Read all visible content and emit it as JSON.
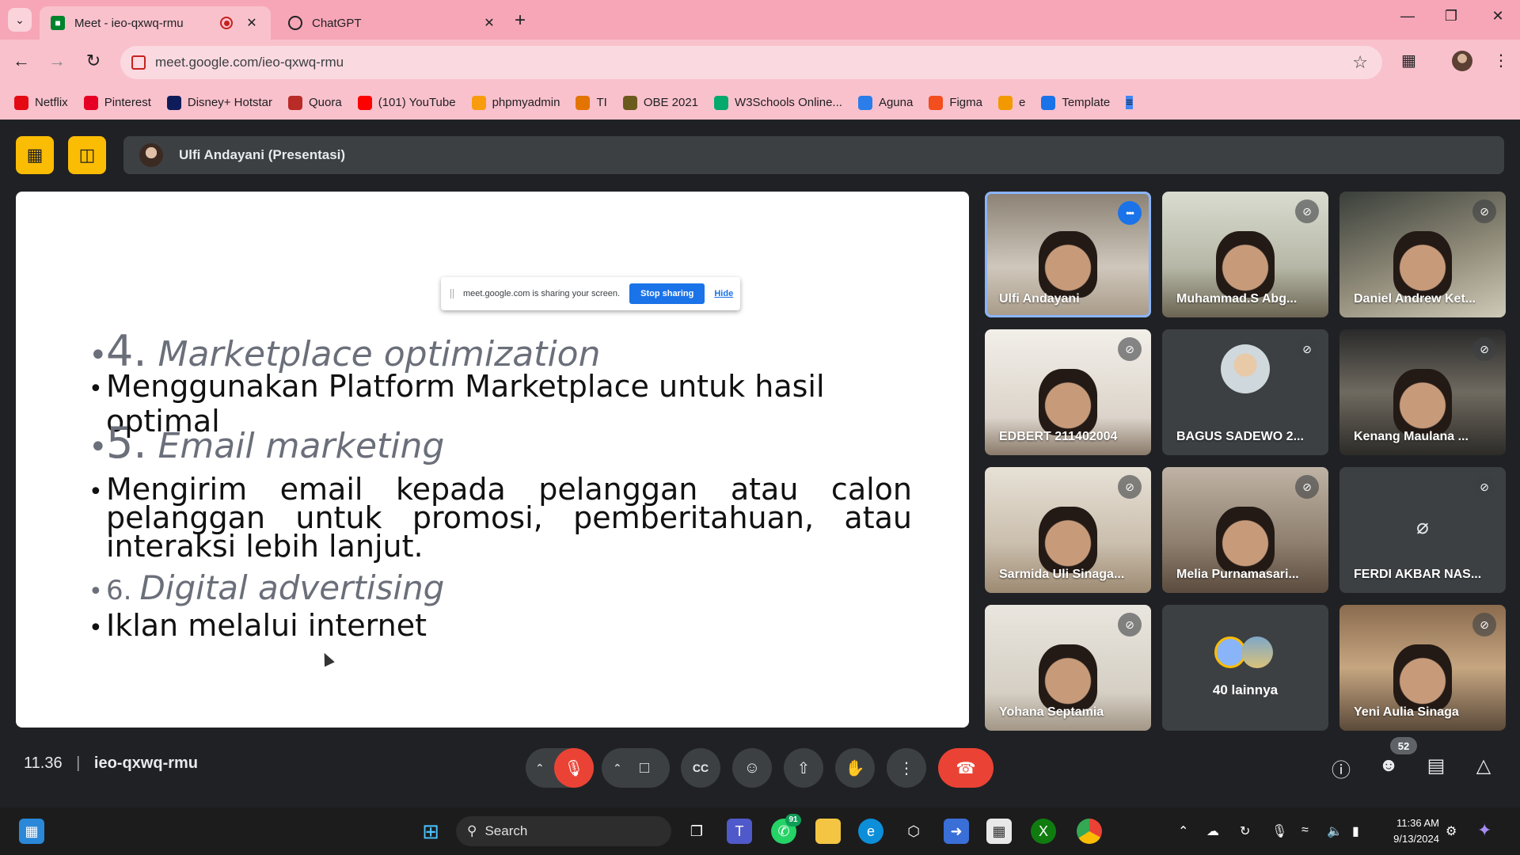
{
  "browser": {
    "tabs": [
      {
        "title": "Meet - ieo-qxwq-rmu",
        "active": true
      },
      {
        "title": "ChatGPT",
        "active": false
      }
    ],
    "url": "meet.google.com/ieo-qxwq-rmu",
    "bookmarks": [
      {
        "label": "Netflix",
        "icon": "netflix-icon",
        "color": "#e50914"
      },
      {
        "label": "Pinterest",
        "icon": "pinterest-icon",
        "color": "#e60023"
      },
      {
        "label": "Disney+ Hotstar",
        "icon": "hotstar-icon",
        "color": "#0f1c5a"
      },
      {
        "label": "Quora",
        "icon": "quora-icon",
        "color": "#b92b27"
      },
      {
        "label": "(101) YouTube",
        "icon": "youtube-icon",
        "color": "#ff0000"
      },
      {
        "label": "phpmyadmin",
        "icon": "phpmyadmin-icon",
        "color": "#f89c0e"
      },
      {
        "label": "TI",
        "icon": "ti-icon",
        "color": "#e37400"
      },
      {
        "label": "OBE 2021",
        "icon": "obe-icon",
        "color": "#6b5a1e"
      },
      {
        "label": "W3Schools Online...",
        "icon": "w3schools-icon",
        "color": "#04aa6d"
      },
      {
        "label": "Aguna",
        "icon": "aguna-icon",
        "color": "#2b7de9"
      },
      {
        "label": "Figma",
        "icon": "figma-icon",
        "color": "#f24e1e"
      },
      {
        "label": "e",
        "icon": "e-icon",
        "color": "#f29900"
      },
      {
        "label": "Template",
        "icon": "template-icon",
        "color": "#1a73e8"
      }
    ]
  },
  "meet": {
    "presenter_label": "Ulfi Andayani (Presentasi)",
    "share_popup": {
      "message": "meet.google.com is sharing your screen.",
      "stop_label": "Stop sharing",
      "hide_label": "Hide"
    },
    "slide": {
      "h4_num": "4.",
      "h4_text": "Marketplace optimization",
      "b4": "Menggunakan Platform Marketplace untuk hasil optimal",
      "h5_num": "5.",
      "h5_text": "Email marketing",
      "b5": "Mengirim email kepada pelanggan atau calon pelanggan untuk promosi, pemberitahuan, atau interaksi lebih lanjut.",
      "h6_num": "6.",
      "h6_text": "Digital advertising",
      "b6": "Iklan melalui internet"
    },
    "participants": [
      {
        "name": "Ulfi Andayani",
        "speaking": true
      },
      {
        "name": "Muhammad.S Abg..."
      },
      {
        "name": "Daniel Andrew Ket..."
      },
      {
        "name": "EDBERT 211402004"
      },
      {
        "name": "BAGUS SADEWO 2..."
      },
      {
        "name": "Kenang Maulana ..."
      },
      {
        "name": "Sarmida Uli Sinaga..."
      },
      {
        "name": "Melia Purnamasari..."
      },
      {
        "name": "FERDI AKBAR NAS..."
      },
      {
        "name": "Yohana Septamia"
      },
      {
        "name": "40 lainnya"
      },
      {
        "name": "Yeni Aulia Sinaga"
      }
    ],
    "time": "11.36",
    "meeting_code": "ieo-qxwq-rmu",
    "people_count": "52"
  },
  "taskbar": {
    "search_placeholder": "Search",
    "whatsapp_badge": "91",
    "clock_time": "11:36 AM",
    "clock_date": "9/13/2024"
  }
}
